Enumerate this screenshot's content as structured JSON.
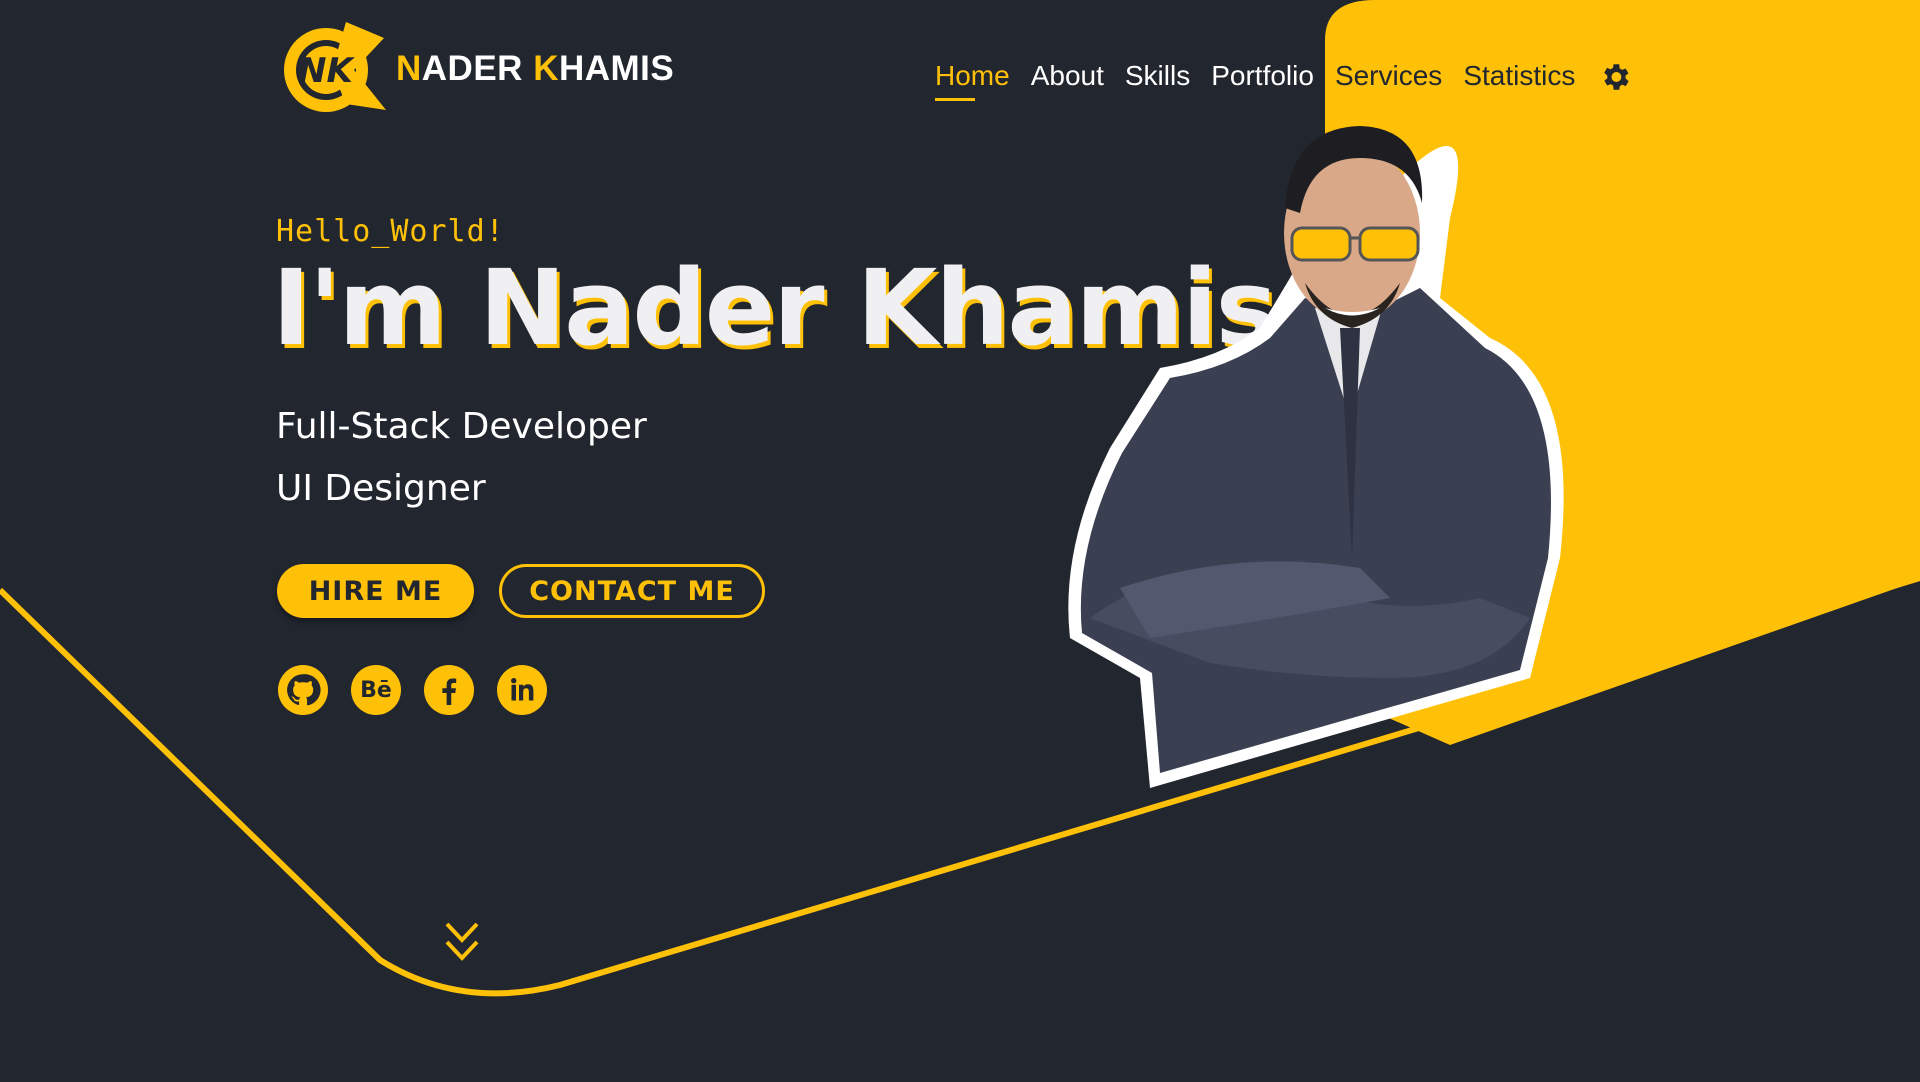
{
  "brand": {
    "initial_first": "N",
    "rest_first": "ADER ",
    "initial_last": "K",
    "rest_last": "HAMIS",
    "logo_icon": "nk-monogram-logo"
  },
  "nav": {
    "items": [
      {
        "label": "Home",
        "active": true
      },
      {
        "label": "About"
      },
      {
        "label": "Skills"
      },
      {
        "label": "Portfolio"
      },
      {
        "label": "Services"
      },
      {
        "label": "Statistics"
      }
    ],
    "settings_icon": "gear-icon"
  },
  "hero": {
    "greeting": "Hello_World!",
    "title": "I'm Nader Khamis",
    "roles": [
      "Full-Stack Developer",
      "UI Designer"
    ],
    "buttons": {
      "hire": "HIRE ME",
      "contact": "CONTACT ME"
    },
    "socials": [
      {
        "name": "github-icon"
      },
      {
        "name": "behance-icon",
        "text": "Bē"
      },
      {
        "name": "facebook-icon"
      },
      {
        "name": "linkedin-icon"
      }
    ],
    "scroll_icon": "chevron-double-down-icon"
  },
  "colors": {
    "background": "#22262f",
    "accent": "#ffc107",
    "text": "#ffffff"
  }
}
